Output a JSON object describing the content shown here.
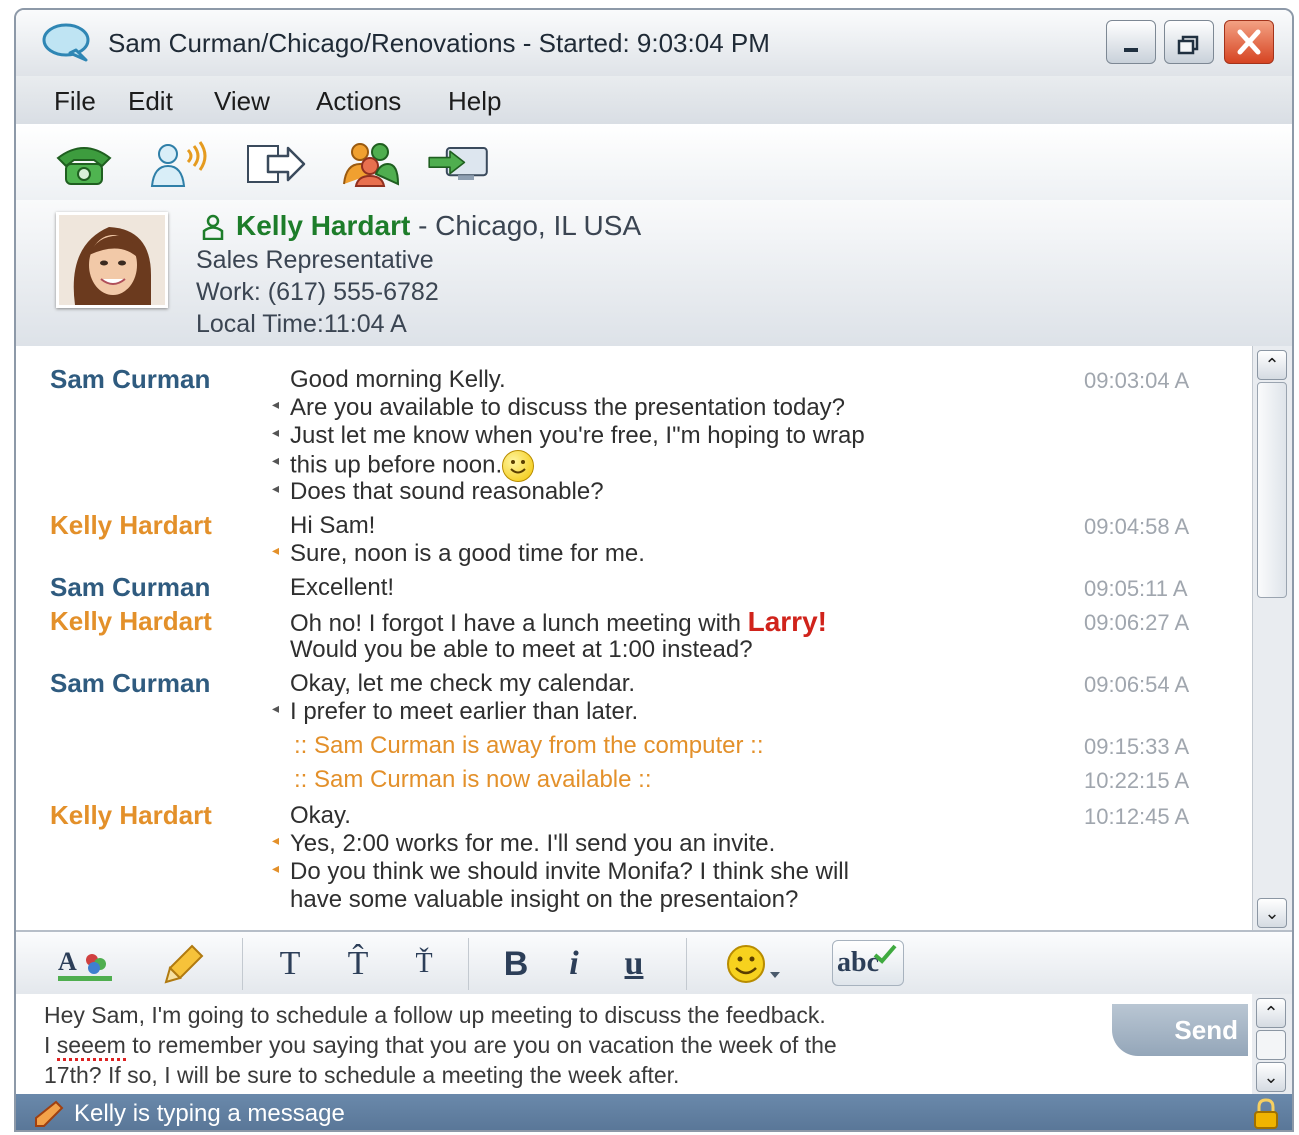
{
  "window": {
    "title": "Sam Curman/Chicago/Renovations - Started: 9:03:04 PM"
  },
  "menu": [
    "File",
    "Edit",
    "View",
    "Actions",
    "Help"
  ],
  "toolbar_icons": [
    "phone-icon",
    "voice-call-icon",
    "transfer-icon",
    "group-chat-icon",
    "share-screen-icon"
  ],
  "contact": {
    "name": "Kelly Hardart",
    "location": " - Chicago, IL USA",
    "title": "Sales Representative",
    "work": "Work: (617) 555-6782",
    "local_time": "Local Time:11:04 A"
  },
  "chat": {
    "messages": [
      {
        "sender": "Sam Curman",
        "lines": [
          "Good morning Kelly.",
          "Are you available to discuss the presentation today?",
          "Just let me know when you're free, I\"m hoping to wrap",
          "this up before noon.",
          "Does that sound reasonable?"
        ],
        "time": "09:03:04 A"
      },
      {
        "sender": "Kelly Hardart",
        "lines": [
          "Hi Sam!",
          "Sure, noon is a good time for me."
        ],
        "time": "09:04:58 A"
      },
      {
        "sender": "Sam Curman",
        "lines": [
          "Excellent!"
        ],
        "time": "09:05:11 A"
      },
      {
        "sender": "Kelly Hardart",
        "lines": [
          "Oh no! I forgot I have a lunch meeting with ",
          "Would you be able to meet at 1:00 instead?"
        ],
        "highlight": "Larry!",
        "time": "09:06:27 A"
      },
      {
        "sender": "Sam Curman",
        "lines": [
          "Okay, let me check my calendar.",
          "I prefer to meet earlier than later."
        ],
        "time": "09:06:54 A"
      },
      {
        "status": ":: Sam Curman is away from the computer ::",
        "time": "09:15:33 A"
      },
      {
        "status": ":: Sam Curman is now available ::",
        "time": "10:22:15 A"
      },
      {
        "sender": "Kelly Hardart",
        "lines": [
          "Okay.",
          "Yes, 2:00 works for me. I'll send you an invite.",
          "Do you think we should invite Monifa? I think she will",
          "have some valuable insight on the presentaion?"
        ],
        "time": "10:12:45 A"
      }
    ]
  },
  "format_toolbar": {
    "buttons": [
      "font-color-icon",
      "highlighter-icon",
      "T",
      "T̂",
      "Ť",
      "B",
      "i",
      "u",
      "emoticon-icon",
      "abc"
    ]
  },
  "compose": {
    "line1": "Hey Sam, I'm going to schedule a follow up meeting to discuss the feedback.",
    "line2_a": "I ",
    "line2_misspelled": "seeem",
    "line2_b": " to remember you saying that you are you on vacation the week of the",
    "line3": "17th? If so, I will be sure to schedule a meeting the week after.",
    "send_label": "Send"
  },
  "status_bar": {
    "text": "Kelly is typing a message"
  },
  "colors": {
    "sam": "#2f5b7f",
    "kelly": "#e3902a",
    "highlight": "#d0231b",
    "status_bar": "#587596"
  }
}
